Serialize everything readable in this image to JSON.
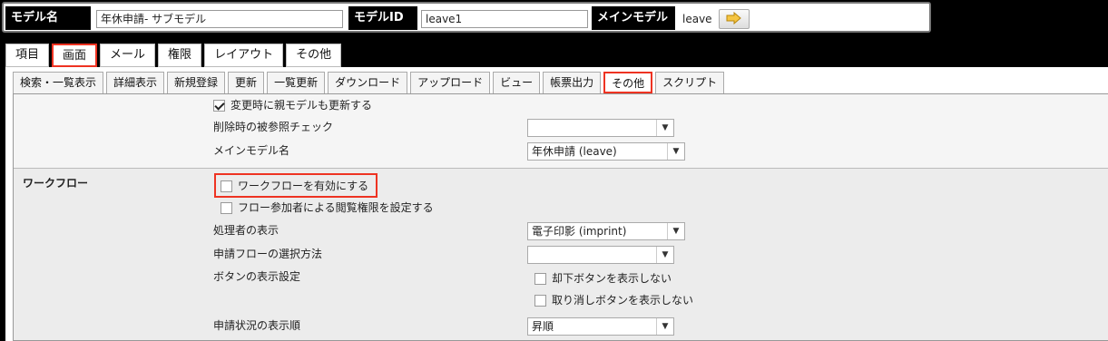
{
  "header": {
    "model_name_label": "モデル名",
    "model_name_value": "年休申請- サブモデル",
    "model_id_label": "モデルID",
    "model_id_value": "leave1",
    "main_model_label": "メインモデル",
    "main_model_value": "leave",
    "goto_icon": "arrow-right-icon"
  },
  "main_tabs": [
    "項目",
    "画面",
    "メール",
    "権限",
    "レイアウト",
    "その他"
  ],
  "main_tab_selected": "画面",
  "sub_tabs": [
    "検索・一覧表示",
    "詳細表示",
    "新規登録",
    "更新",
    "一覧更新",
    "ダウンロード",
    "アップロード",
    "ビュー",
    "帳票出力",
    "その他",
    "スクリプト"
  ],
  "sub_tab_selected": "その他",
  "section_general": {
    "update_parent_label": "変更時に親モデルも更新する",
    "update_parent_checked": true,
    "ref_check_label": "削除時の被参照チェック",
    "ref_check_value": "",
    "main_model_name_label": "メインモデル名",
    "main_model_name_value": "年休申請 (leave)"
  },
  "section_workflow": {
    "title": "ワークフロー",
    "enable_label": "ワークフローを有効にする",
    "enable_checked": false,
    "perm_label": "フロー参加者による閲覧権限を設定する",
    "perm_checked": false,
    "processor_label": "処理者の表示",
    "processor_value": "電子印影 (imprint)",
    "flow_select_label": "申請フローの選択方法",
    "flow_select_value": "",
    "button_label": "ボタンの表示設定",
    "hide_reject_label": "却下ボタンを表示しない",
    "hide_reject_checked": false,
    "hide_cancel_label": "取り消しボタンを表示しない",
    "hide_cancel_checked": false,
    "status_order_label": "申請状況の表示順",
    "status_order_value": "昇順"
  }
}
